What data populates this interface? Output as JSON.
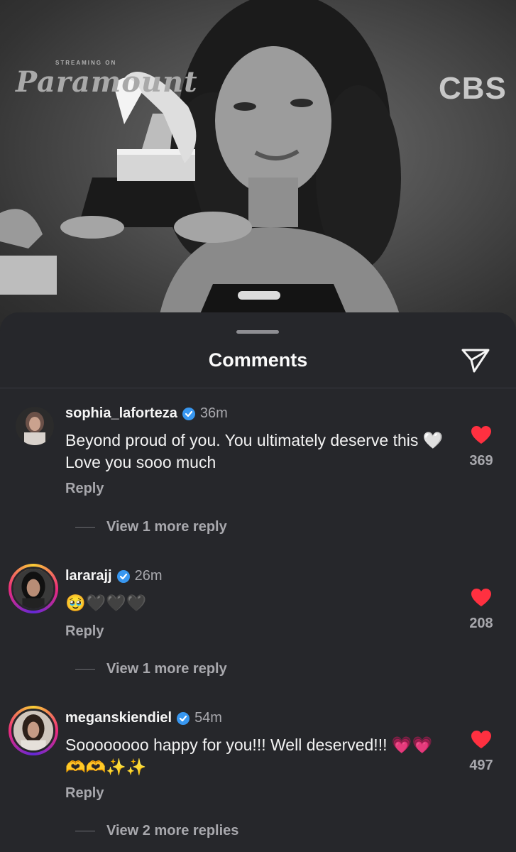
{
  "photo": {
    "streaming_text": "STREAMING ON",
    "paramount_text": "Paramount",
    "cbs_text": "CBS"
  },
  "sheet": {
    "title": "Comments",
    "share_icon": "paper-plane-icon"
  },
  "comments": [
    {
      "username": "sophia_laforteza",
      "verified": true,
      "time": "36m",
      "text": "Beyond proud of you. You ultimately deserve this 🤍 Love you sooo much",
      "reply_label": "Reply",
      "view_more": "View 1 more reply",
      "likes": "369",
      "story_ring": false
    },
    {
      "username": "lararajj",
      "verified": true,
      "time": "26m",
      "text": "🥹🖤🖤🖤",
      "reply_label": "Reply",
      "view_more": "View 1 more reply",
      "likes": "208",
      "story_ring": true
    },
    {
      "username": "meganskiendiel",
      "verified": true,
      "time": "54m",
      "text": "Soooooooo happy for you!!! Well deserved!!! 💗💗🫶🫶✨✨",
      "reply_label": "Reply",
      "view_more": "View 2 more replies",
      "likes": "497",
      "story_ring": true
    }
  ],
  "colors": {
    "background": "#26272b",
    "heart": "#ff3040",
    "verified": "#3897f0",
    "muted_text": "#a8a8ad"
  }
}
